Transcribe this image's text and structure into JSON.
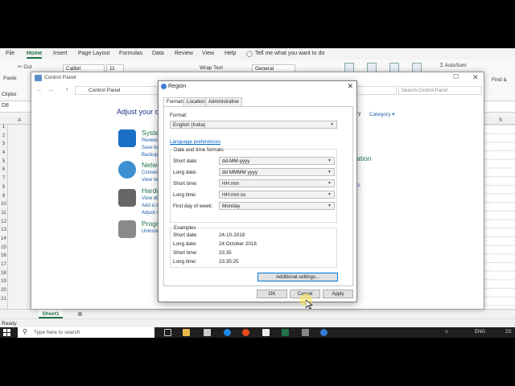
{
  "excel": {
    "menu": [
      "File",
      "Home",
      "Insert",
      "Page Layout",
      "Formulas",
      "Data",
      "Review",
      "View",
      "Help"
    ],
    "active_menu": "Home",
    "tell_me": "Tell me what you want to do",
    "cut": "Cut",
    "paste": "Paste",
    "clipboard": "Clipbo",
    "font_name": "Calibri",
    "font_size": "11",
    "wrap_text": "Wrap Text",
    "number_format": "General",
    "autosum": "AutoSum",
    "find_select": "Find &",
    "name_box": "D8",
    "col_headers": [
      "A",
      "S"
    ],
    "row_numbers": [
      "1",
      "2",
      "3",
      "4",
      "5",
      "6",
      "7",
      "8",
      "9",
      "10",
      "11",
      "12",
      "13",
      "14",
      "15",
      "16",
      "17",
      "18",
      "19",
      "20",
      "21"
    ],
    "sheet_tab": "Sheet1",
    "status": "Ready"
  },
  "control_panel": {
    "title": "Control Panel",
    "path": "Control Panel",
    "search_placeholder": "Search Control Panel",
    "heading": "Adjust your co",
    "view_by": "ry",
    "category": "Category",
    "categories": [
      {
        "name": "Syster",
        "subs": [
          "Review",
          "Save ba",
          "Backup"
        ]
      },
      {
        "name": "Netwo",
        "subs": [
          "Connec",
          "View ne"
        ]
      },
      {
        "name": "Hardw",
        "subs": [
          "View de",
          "Add a d",
          "Adjust c"
        ]
      },
      {
        "name": "Progra",
        "subs": [
          "Uninsta"
        ]
      }
    ],
    "right_cat": "ation",
    "right_link": "ts"
  },
  "dialog": {
    "title": "Region",
    "tabs": [
      "Formats",
      "Location",
      "Administrative"
    ],
    "format_label": "Format:",
    "format_value": "English (India)",
    "language_prefs": "Language preferences",
    "dt_group": "Date and time formats",
    "fields": [
      {
        "label": "Short date:",
        "value": "dd-MM-yyyy"
      },
      {
        "label": "Long date:",
        "value": "dd MMMM yyyy"
      },
      {
        "label": "Short time:",
        "value": "HH:mm"
      },
      {
        "label": "Long time:",
        "value": "HH:mm:ss"
      },
      {
        "label": "First day of week:",
        "value": "Monday"
      }
    ],
    "examples_title": "Examples",
    "examples": [
      {
        "label": "Short date:",
        "value": "24-10-2018"
      },
      {
        "label": "Long date:",
        "value": "24 October 2018"
      },
      {
        "label": "Short time:",
        "value": "23:35"
      },
      {
        "label": "Long time:",
        "value": "23:35:25"
      }
    ],
    "additional": "Additional settings...",
    "ok": "OK",
    "cancel": "Cancel",
    "apply": "Apply"
  },
  "taskbar": {
    "search_text": "Type here to search",
    "lang": "ENG",
    "clock": "23:"
  }
}
